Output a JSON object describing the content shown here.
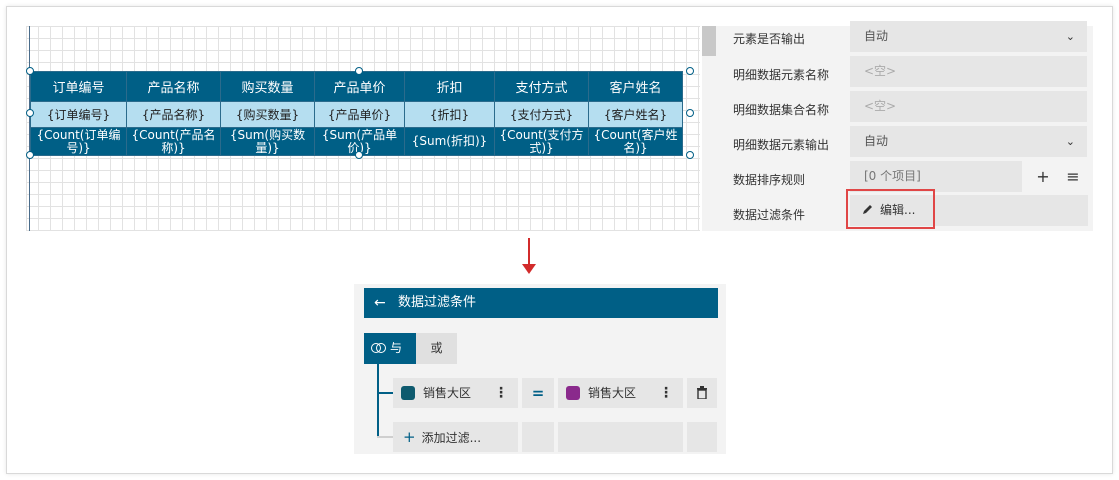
{
  "table": {
    "headers": [
      "订单编号",
      "产品名称",
      "购买数量",
      "产品单价",
      "折扣",
      "支付方式",
      "客户姓名"
    ],
    "fields": [
      "{订单编号}",
      "{产品名称}",
      "{购买数量}",
      "{产品单价}",
      "{折扣}",
      "{支付方式}",
      "{客户姓名}"
    ],
    "summaries": [
      "{Count(订单编号)}",
      "{Count(产品名称)}",
      "{Sum(购买数量)}",
      "{Sum(产品单价)}",
      "{Sum(折扣)}",
      "{Count(支付方式)}",
      "{Count(客户姓名)}"
    ]
  },
  "props": {
    "rows": [
      {
        "label": "元素是否输出",
        "value": "自动"
      },
      {
        "label": "明细数据元素名称",
        "value": "<空>"
      },
      {
        "label": "明细数据集合名称",
        "value": "<空>"
      },
      {
        "label": "明细数据元素输出",
        "value": "自动"
      },
      {
        "label": "数据排序规则",
        "value": "[0 个项目]"
      },
      {
        "label": "数据过滤条件",
        "value": "编辑..."
      }
    ],
    "add_symbol": "+",
    "menu_symbol": "≡"
  },
  "dialog": {
    "title": "数据过滤条件",
    "and_label": "与",
    "or_label": "或",
    "field_label": "销售大区",
    "operator": "=",
    "param_label": "销售大区",
    "add_filter_label": "添加过滤..."
  },
  "colors": {
    "primary": "#005f86",
    "field_row": "#b5def0",
    "highlight": "#e04646"
  }
}
